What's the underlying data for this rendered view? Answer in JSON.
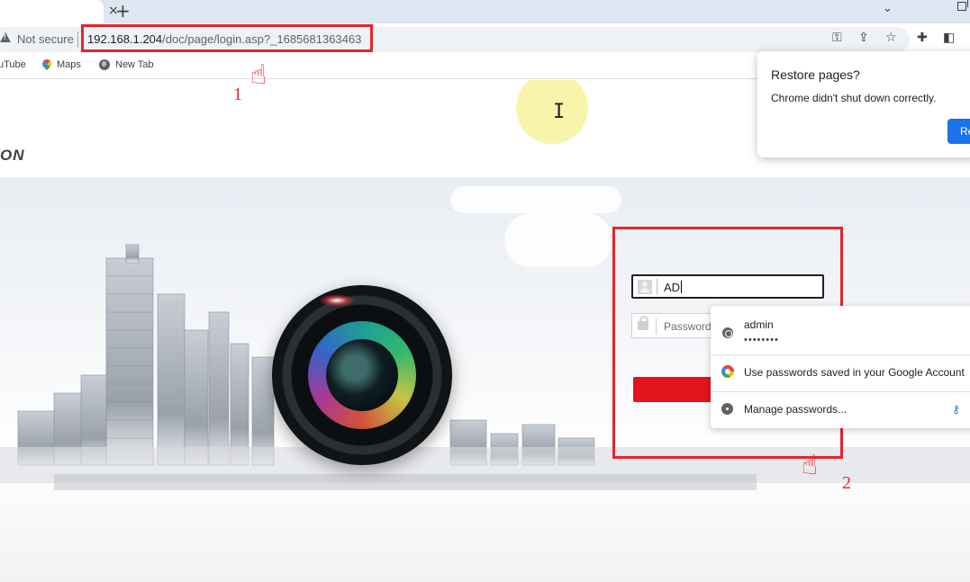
{
  "browser": {
    "tab_close": "×",
    "tab_new": "+",
    "tab_search": "⌄",
    "security_label": "Not secure",
    "url_host": "192.168.1.204",
    "url_path": "/doc/page/login.asp?_1685681363463",
    "toolbar_icons": [
      "key-icon",
      "share-icon",
      "star-icon",
      "extensions-icon",
      "sidepanel-icon"
    ]
  },
  "bookmarks": [
    {
      "label": "uTube",
      "icon": "youtube-icon"
    },
    {
      "label": "Maps",
      "icon": "maps-icon"
    },
    {
      "label": "New Tab",
      "icon": "globe-icon"
    }
  ],
  "page": {
    "logo_fragment": "ON",
    "username_value": "AD",
    "password_placeholder": "Password"
  },
  "autofill": {
    "saved_user": "admin",
    "saved_password_mask": "••••••••",
    "google_passwords": "Use passwords saved in your Google Account",
    "manage": "Manage passwords..."
  },
  "restore_popup": {
    "title": "Restore pages?",
    "message": "Chrome didn't shut down correctly.",
    "button": "Re"
  },
  "annotations": {
    "step1": "1",
    "step2": "2",
    "color": "#e4252b"
  },
  "colors": {
    "login_button": "#e3141b",
    "chrome_accent": "#1a73e8"
  }
}
